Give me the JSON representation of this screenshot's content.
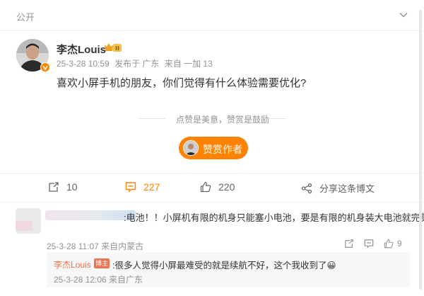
{
  "post": {
    "visibility": "公开",
    "author": "李杰Louis",
    "crown_level": "II",
    "timestamp": "25-3-28 10:59",
    "published_location": "发布于 广东",
    "source": "来自 一加 13",
    "content": "喜欢小屏手机的朋友，你们觉得有什么体验需要优化?",
    "like_hint": "点赞是美意，赞赏是鼓励",
    "reward_label": "赞赏作者"
  },
  "toolbar": {
    "repost_count": "10",
    "comment_count": "227",
    "like_count": "220",
    "share_label": "分享这条博文"
  },
  "comment": {
    "text": ":电池！！小屏机有限的机身只能塞小电池，要是有限的机身装大电池就完美",
    "meta": "25-3-28 11:07 来自内蒙古",
    "like_count": "9"
  },
  "reply": {
    "author": "李杰Louis",
    "tag": "博主",
    "text": ":很多人觉得小屏最难受的就是续航不好，这个我收到了😀",
    "meta": "25-3-28 12:06 来自广东"
  },
  "colors": {
    "accent": "#ff8200",
    "reply_name": "#eb7350",
    "muted": "#939393"
  }
}
